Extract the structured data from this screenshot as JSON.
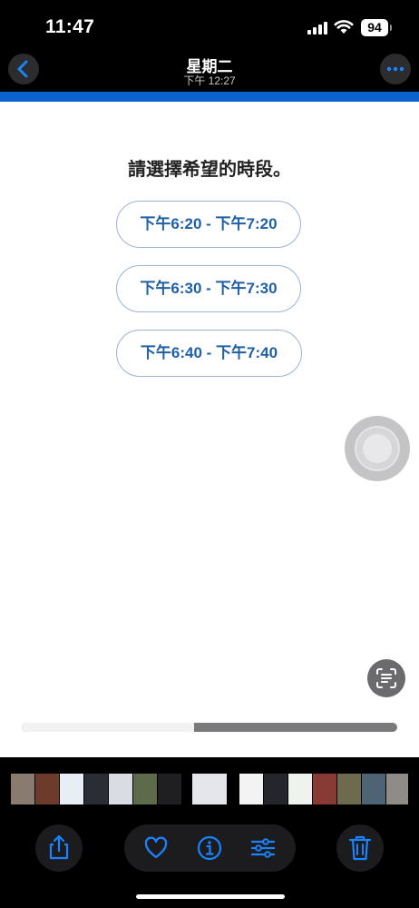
{
  "status_bar": {
    "time": "11:47",
    "battery": "94"
  },
  "nav": {
    "title": "星期二",
    "subtitle": "下午 12:27"
  },
  "photo": {
    "prompt": "請選擇希望的時段。",
    "time_slots": [
      "下午6:20 - 下午7:20",
      "下午6:30 - 下午7:30",
      "下午6:40 - 下午7:40"
    ]
  },
  "video": {
    "progress_fraction": 0.46
  },
  "colors": {
    "accent": "#1a84ff",
    "slot_text": "#1f5fa6",
    "strip": "#0b63ce"
  },
  "icons": {
    "back": "chevron-left-icon",
    "more": "ellipsis-icon",
    "play": "play-icon",
    "live_text": "live-text-icon",
    "share": "share-icon",
    "favorite": "heart-icon",
    "info": "info-icon",
    "adjust": "sliders-icon",
    "delete": "trash-icon"
  }
}
